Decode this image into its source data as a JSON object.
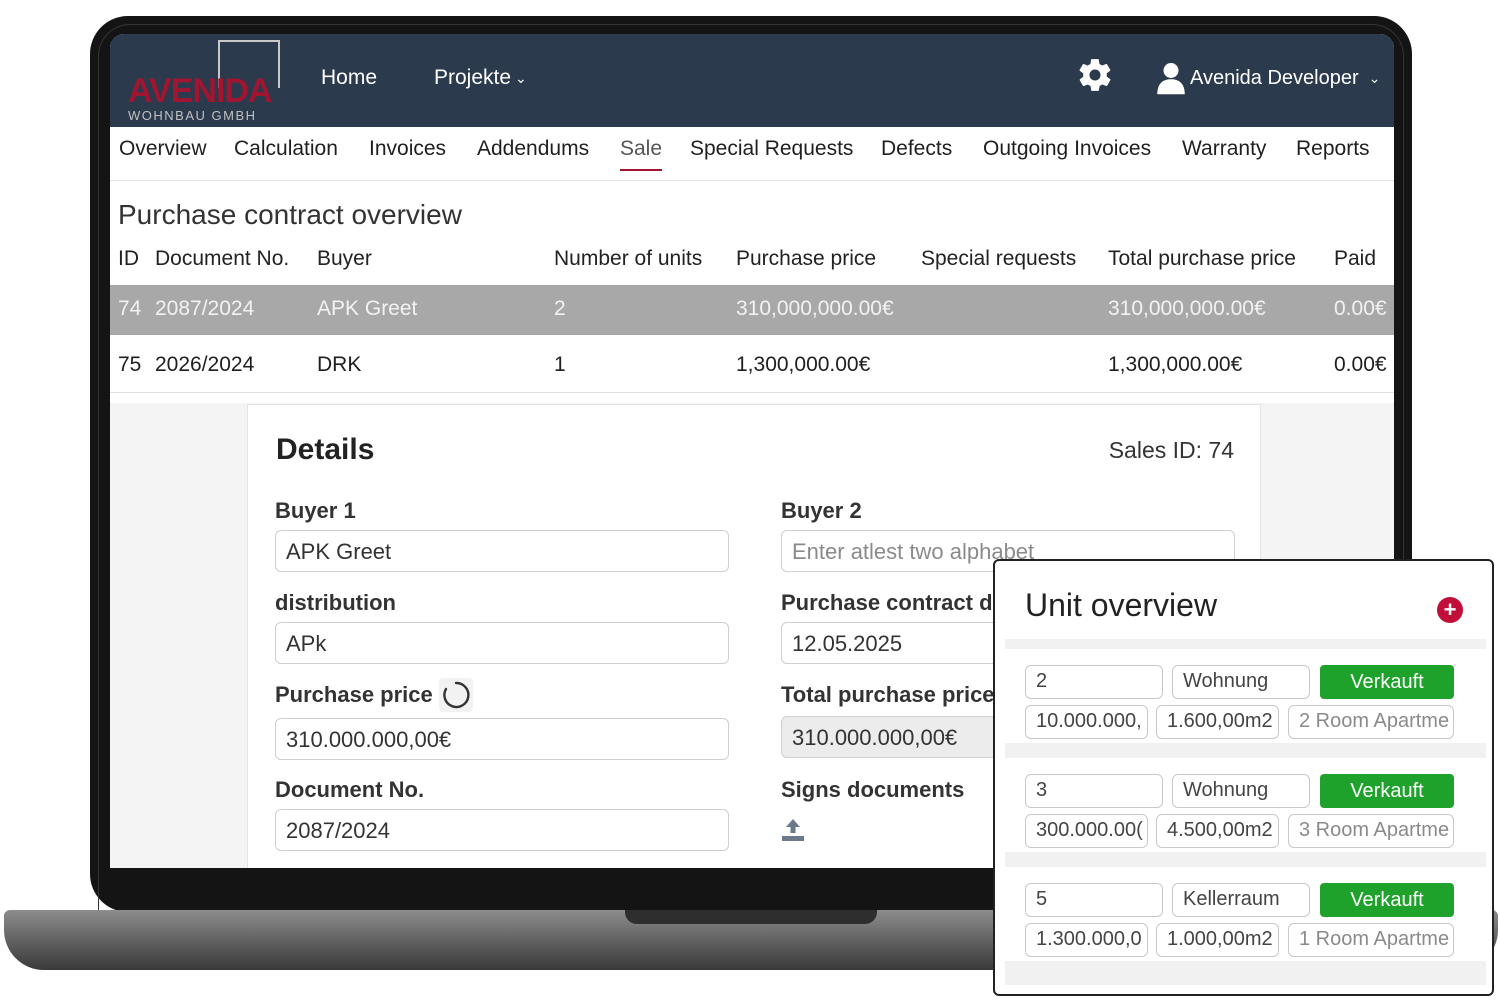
{
  "brand": {
    "name": "AVENIDA",
    "sub": "WOHNBAU GMBH",
    "accent": "#a01530"
  },
  "topnav": {
    "home": "Home",
    "projects": "Projekte",
    "user_name": "Avenida Developer"
  },
  "subnav": {
    "items": [
      "Overview",
      "Calculation",
      "Invoices",
      "Addendums",
      "Sale",
      "Special Requests",
      "Defects",
      "Outgoing Invoices",
      "Warranty",
      "Reports"
    ],
    "active": "Sale"
  },
  "overview": {
    "title": "Purchase contract overview",
    "columns": [
      "ID",
      "Document No.",
      "Buyer",
      "Number of units",
      "Purchase price",
      "Special requests",
      "Total purchase price",
      "Paid"
    ],
    "rows": [
      {
        "id": "74",
        "doc": "2087/2024",
        "buyer": "APK Greet",
        "units": "2",
        "price": "310,000,000.00€",
        "special": "",
        "total": "310,000,000.00€",
        "paid": "0.00€"
      },
      {
        "id": "75",
        "doc": "2026/2024",
        "buyer": "DRK",
        "units": "1",
        "price": "1,300,000.00€",
        "special": "",
        "total": "1,300,000.00€",
        "paid": "0.00€"
      }
    ]
  },
  "details": {
    "title": "Details",
    "sales_id": "Sales ID: 74",
    "buyer1_label": "Buyer 1",
    "buyer1_value": "APK Greet",
    "buyer2_label": "Buyer 2",
    "buyer2_placeholder": "Enter atlest two alphabet",
    "distribution_label": "distribution",
    "distribution_value": "APk",
    "contract_date_label": "Purchase contract d",
    "contract_date_value": "12.05.2025",
    "price_label": "Purchase price",
    "price_value": "310.000.000,00€",
    "total_label": "Total purchase price",
    "total_value": "310.000.000,00€",
    "docno_label": "Document No.",
    "docno_value": "2087/2024",
    "signs_label": "Signs documents"
  },
  "units": {
    "title": "Unit overview",
    "sold_label": "Verkauft",
    "items": [
      {
        "number": "2",
        "type": "Wohnung",
        "price": "10.000.000,",
        "area": "1.600,00m2",
        "desc": "2 Room Apartme"
      },
      {
        "number": "3",
        "type": "Wohnung",
        "price": "300.000.00(",
        "area": "4.500,00m2",
        "desc": "3 Room Apartme"
      },
      {
        "number": "5",
        "type": "Kellerraum",
        "price": "1.300.000,0",
        "area": "1.000,00m2",
        "desc": "1 Room Apartme"
      }
    ]
  },
  "icons": {
    "settings": "gear-icon",
    "user": "user-icon",
    "chevron": "chevron-down-icon",
    "upload": "upload-icon",
    "add": "plus-circle-icon",
    "loading": "spinner-icon"
  }
}
